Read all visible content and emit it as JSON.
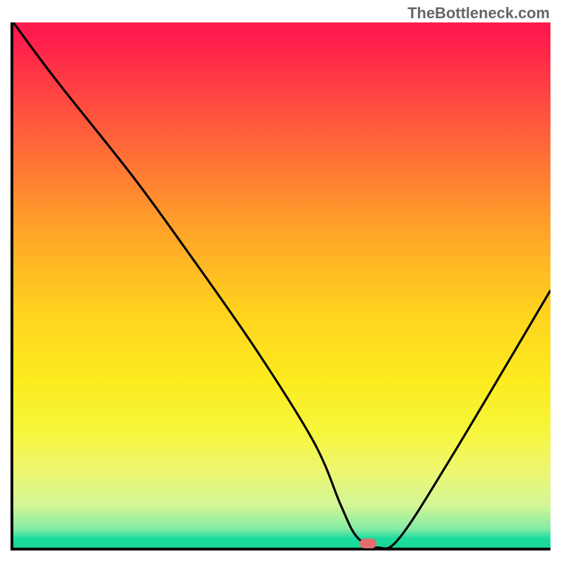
{
  "watermark": "TheBottleneck.com",
  "chart_data": {
    "type": "line",
    "title": "",
    "xlabel": "",
    "ylabel": "",
    "xlim": [
      0,
      100
    ],
    "ylim": [
      0,
      100
    ],
    "grid": false,
    "legend": false,
    "series": [
      {
        "name": "bottleneck-curve",
        "x": [
          0,
          8,
          22,
          32,
          45,
          56,
          61,
          64,
          68,
          72,
          82,
          100
        ],
        "values": [
          100,
          89,
          71,
          57,
          38,
          20,
          8,
          2,
          0,
          2,
          18,
          49
        ]
      }
    ],
    "marker": {
      "x": 66,
      "y": 0.8,
      "color": "#e26d6d"
    },
    "background_gradient": {
      "stops": [
        {
          "pos": 0,
          "color": "#ff1a4d"
        },
        {
          "pos": 0.25,
          "color": "#ff6e37"
        },
        {
          "pos": 0.55,
          "color": "#ffd21e"
        },
        {
          "pos": 0.78,
          "color": "#f6f63c"
        },
        {
          "pos": 0.96,
          "color": "#82eba5"
        },
        {
          "pos": 1.0,
          "color": "#14d796"
        }
      ]
    }
  }
}
